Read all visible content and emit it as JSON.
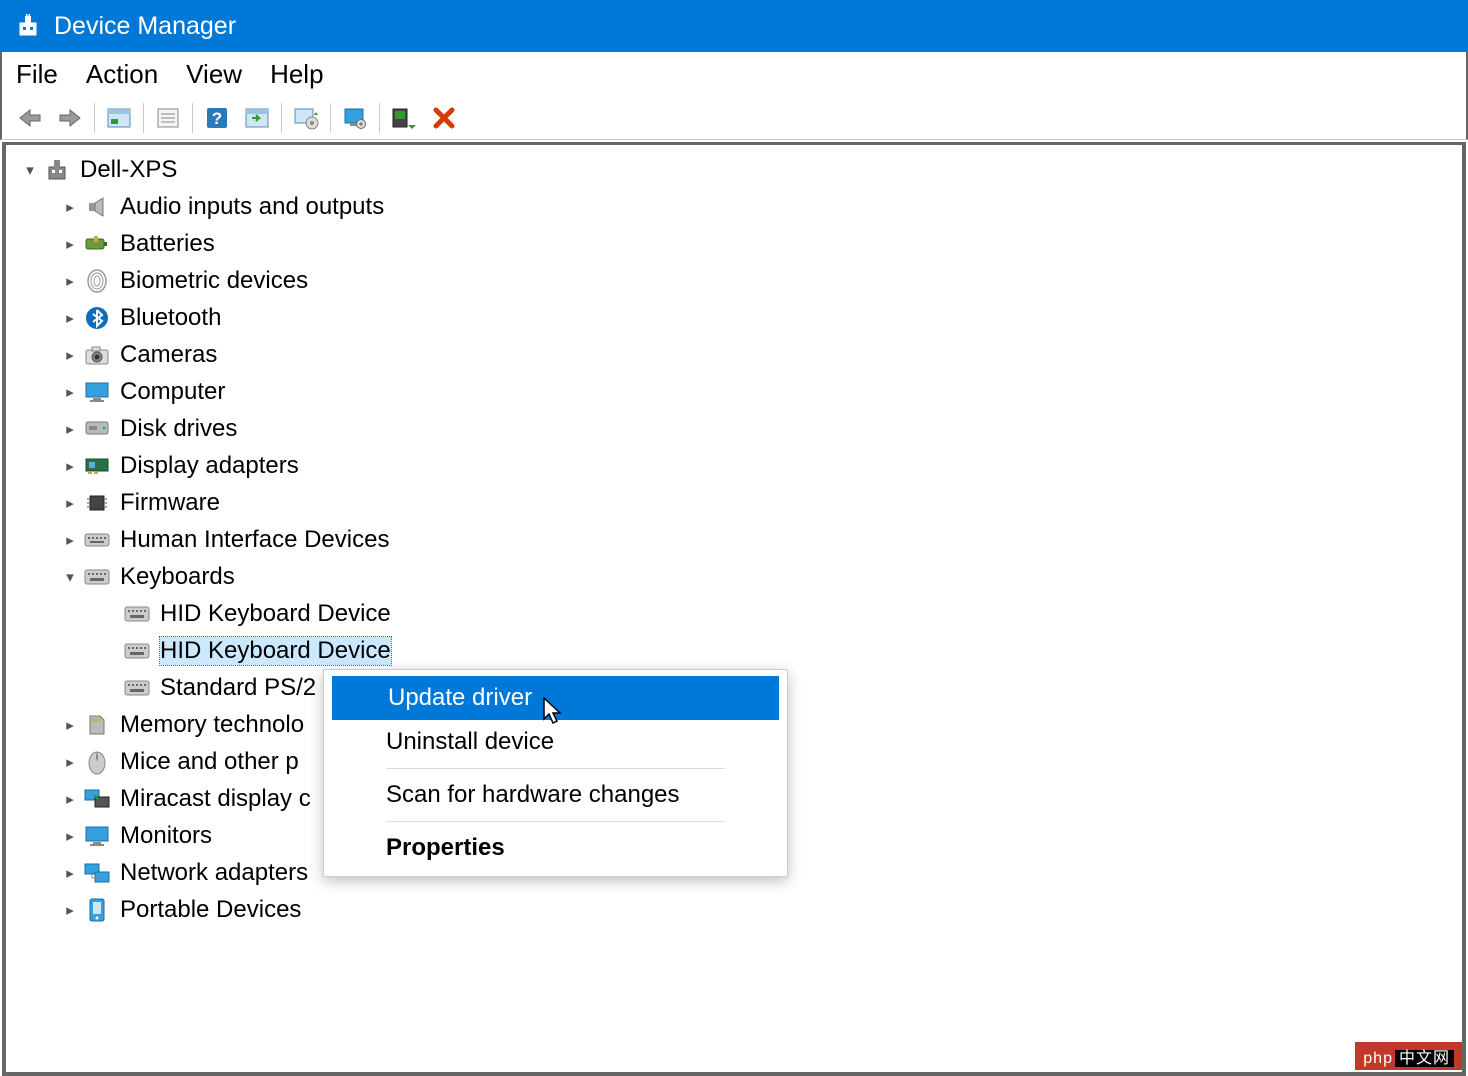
{
  "window": {
    "title": "Device Manager"
  },
  "menu": {
    "file": "File",
    "action": "Action",
    "view": "View",
    "help": "Help"
  },
  "tree": {
    "root": "Dell-XPS",
    "items": [
      {
        "label": "Audio inputs and outputs",
        "icon": "speaker"
      },
      {
        "label": "Batteries",
        "icon": "battery"
      },
      {
        "label": "Biometric devices",
        "icon": "fingerprint"
      },
      {
        "label": "Bluetooth",
        "icon": "bluetooth"
      },
      {
        "label": "Cameras",
        "icon": "camera"
      },
      {
        "label": "Computer",
        "icon": "monitor"
      },
      {
        "label": "Disk drives",
        "icon": "disk"
      },
      {
        "label": "Display adapters",
        "icon": "gpu"
      },
      {
        "label": "Firmware",
        "icon": "chip"
      },
      {
        "label": "Human Interface Devices",
        "icon": "hid"
      },
      {
        "label": "Keyboards",
        "icon": "keyboard",
        "expanded": true,
        "children": [
          {
            "label": "HID Keyboard Device",
            "icon": "keyboard"
          },
          {
            "label": "HID Keyboard Device",
            "icon": "keyboard",
            "selected": true
          },
          {
            "label": "Standard PS/2",
            "icon": "keyboard"
          }
        ]
      },
      {
        "label": "Memory technolo",
        "icon": "sd"
      },
      {
        "label": "Mice and other p",
        "icon": "mouse"
      },
      {
        "label": "Miracast display c",
        "icon": "cast"
      },
      {
        "label": "Monitors",
        "icon": "monitor"
      },
      {
        "label": "Network adapters",
        "icon": "net"
      },
      {
        "label": "Portable Devices",
        "icon": "portable"
      }
    ]
  },
  "context_menu": {
    "update": "Update driver",
    "uninstall": "Uninstall device",
    "scan": "Scan for hardware changes",
    "properties": "Properties"
  },
  "watermark": {
    "a": "php",
    "b": "中文网"
  }
}
